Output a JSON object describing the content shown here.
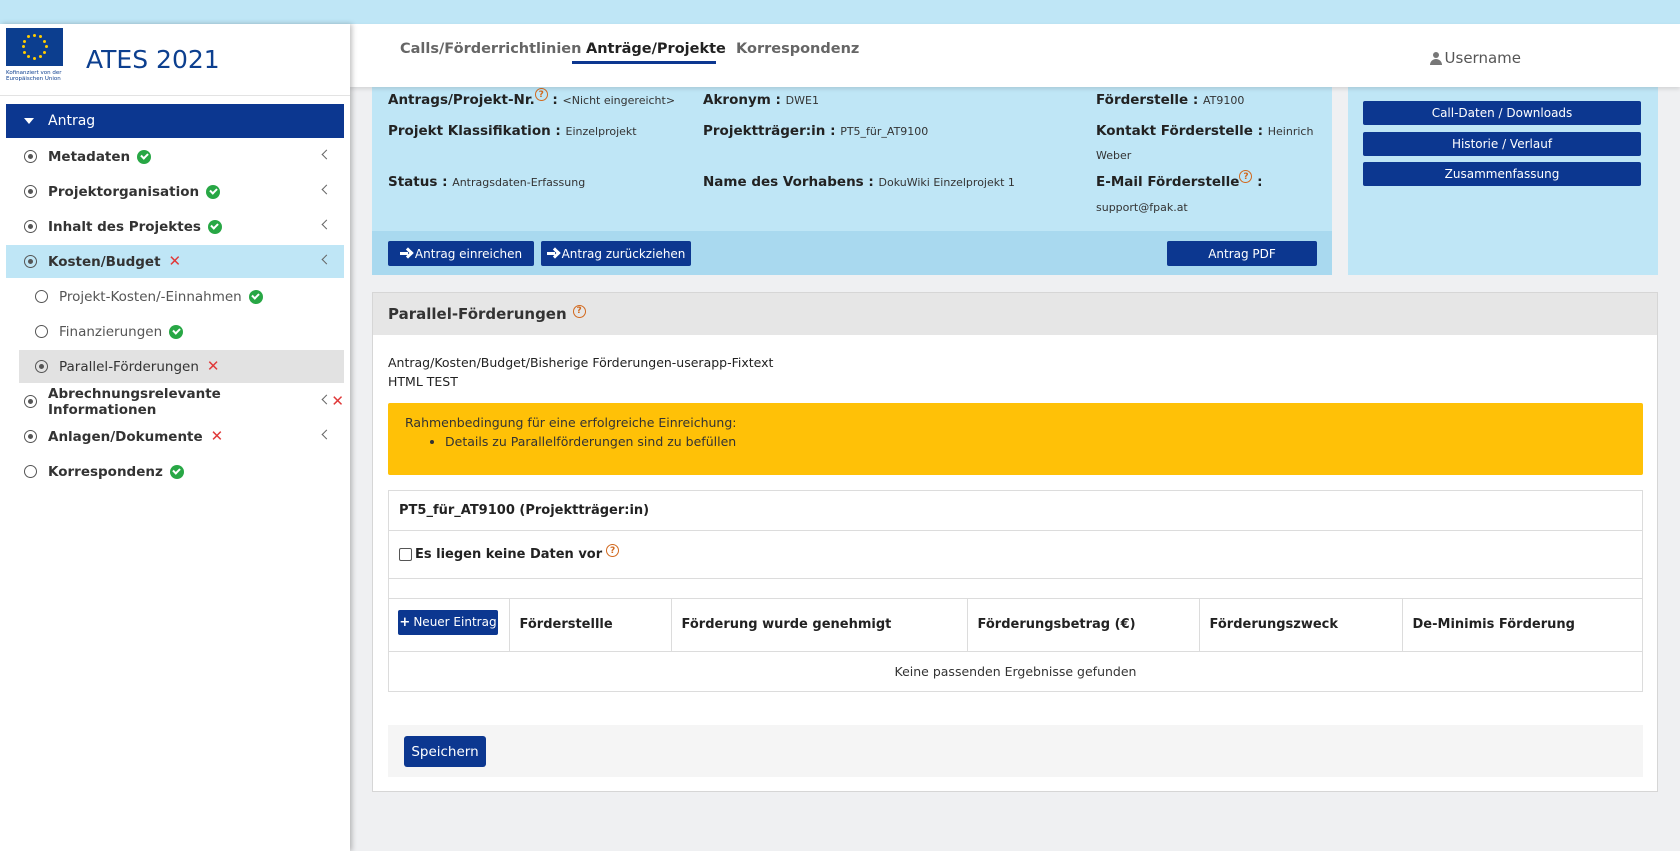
{
  "app": {
    "title": "ATES 2021",
    "logo_caption": "Kofinanziert von der Europäischen Union"
  },
  "header": {
    "tabs": [
      {
        "label": "Calls/Förderrichtlinien"
      },
      {
        "label": "Anträge/Projekte"
      },
      {
        "label": "Korrespondenz"
      }
    ],
    "username": "Username"
  },
  "sidebar": {
    "items": [
      {
        "label": "Antrag"
      },
      {
        "label": "Metadaten"
      },
      {
        "label": "Projektorganisation"
      },
      {
        "label": "Inhalt des Projektes"
      },
      {
        "label": "Kosten/Budget"
      },
      {
        "label": "Projekt-Kosten/-Einnahmen"
      },
      {
        "label": "Finanzierungen"
      },
      {
        "label": "Parallel-Förderungen"
      },
      {
        "label": "Abrechnungsrelevante Informationen"
      },
      {
        "label": "Anlagen/Dokumente"
      },
      {
        "label": "Korrespondenz"
      }
    ]
  },
  "info": {
    "antrag_nr_label": "Antrags/Projekt-Nr.",
    "antrag_nr_sep": " :",
    "antrag_nr_value": "<Nicht eingereicht>",
    "akronym_label": "Akronym :",
    "akronym_value": "DWE1",
    "foerderstelle_label": "Förderstelle :",
    "foerderstelle_value": "AT9100",
    "klassifikation_label": "Projekt Klassifikation :",
    "klassifikation_value": "Einzelprojekt",
    "projekttraeger_label": "Projektträger:in :",
    "projekttraeger_value": "PT5_für_AT9100",
    "kontakt_label": "Kontakt Förderstelle :",
    "kontakt_value_1": "Heinrich",
    "kontakt_value_2": "Weber",
    "status_label": "Status :",
    "status_value": "Antragsdaten-Erfassung",
    "vorhaben_label": "Name des Vorhabens :",
    "vorhaben_value": "DokuWiki Einzelprojekt 1",
    "email_label": "E-Mail Förderstelle",
    "email_sep": " :",
    "email_value": "support@fpak.at",
    "btn_einreichen": "Antrag einreichen",
    "btn_zurueckziehen": "Antrag zurückziehen",
    "btn_pdf": "Antrag PDF"
  },
  "side_buttons": {
    "call_daten": "Call-Daten / Downloads",
    "historie": "Historie / Verlauf",
    "zusammenfassung": "Zusammenfassung"
  },
  "main": {
    "title": "Parallel-Förderungen",
    "fixtext_1": "Antrag/Kosten/Budget/Bisherige Förderungen-userapp-Fixtext",
    "fixtext_2": "HTML TEST",
    "warning_title": "Rahmenbedingung für eine erfolgreiche Einreichung:",
    "warning_item": "Details zu Parallelförderungen sind zu befüllen",
    "group_title": "PT5_für_AT9100 (Projektträger:in)",
    "no_data_label": "Es liegen keine Daten vor",
    "new_entry": "Neuer Eintrag",
    "columns": [
      "Förderstellle",
      "Förderung wurde genehmigt",
      "Förderungsbetrag (€)",
      "Förderungszweck",
      "De-Minimis Förderung"
    ],
    "empty_text": "Keine passenden Ergebnisse gefunden",
    "save": "Speichern"
  },
  "colors": {
    "primary": "#0c3790",
    "info_bg": "#bfe6f6",
    "warning": "#ffc107",
    "ok": "#28a745",
    "error": "#e03a3a"
  }
}
